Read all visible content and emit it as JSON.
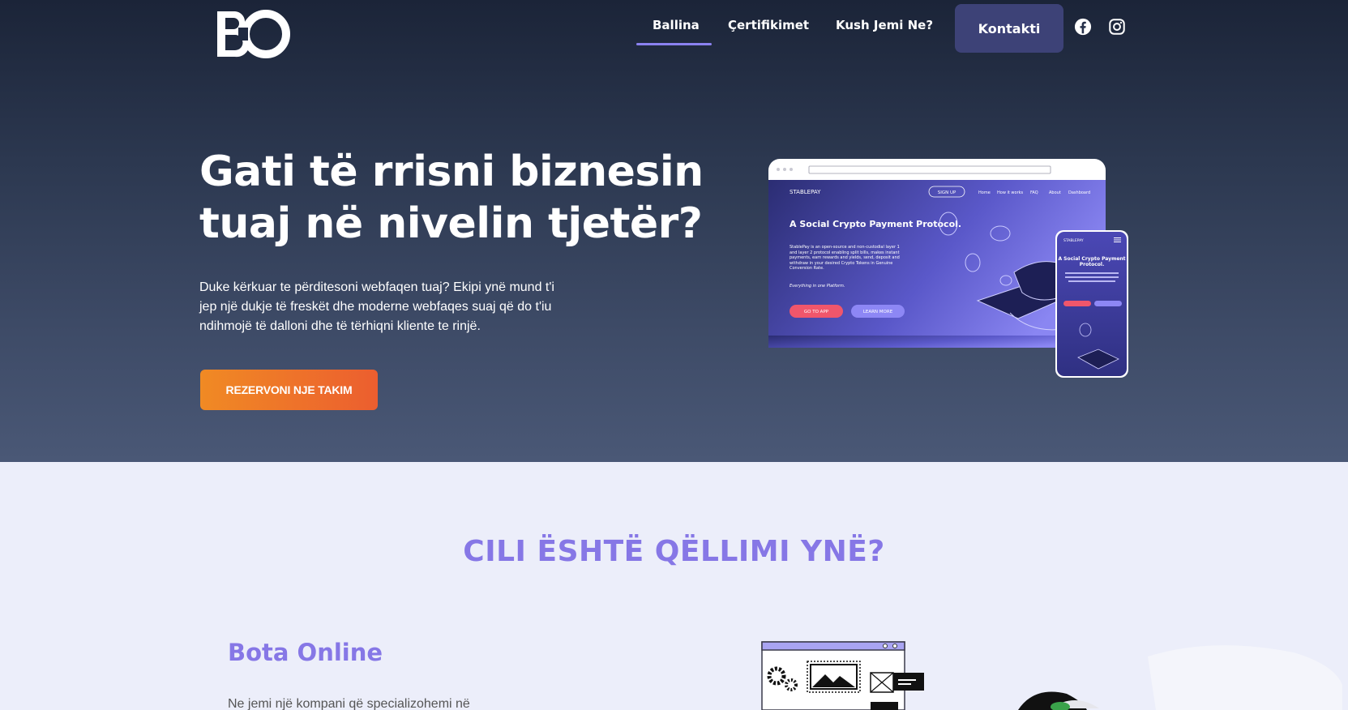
{
  "nav": {
    "logo_text": "BO",
    "links": [
      "Ballina",
      "Çertifikimet",
      "Kush Jemi Ne?"
    ],
    "cta": "Kontakti",
    "social": [
      "facebook-icon",
      "instagram-icon"
    ],
    "accent": "#8b82f0"
  },
  "hero": {
    "title": "Gati të rrisni biznesin tuaj në nivelin tjetër?",
    "text": "Duke kërkuar te përditesoni webfaqen tuaj? Ekipi ynë mund t'i jep një dukje të freskët dhe moderne webfaqes suaj që do t'iu ndihmojë të dalloni dhe të tërhiqni kliente te rinjë.",
    "button": "REZERVONI NJE TAKIM"
  },
  "mockup": {
    "brand": "STABLEPAY",
    "sign_up": "SIGN UP",
    "menu": [
      "Home",
      "How it works",
      "FAQ",
      "About",
      "Dashboard"
    ],
    "headline": "A Social Crypto Payment Protocol.",
    "body": "StablePay is an open-source and non-custodial layer 1 and layer 2 protocol enabling split bills, makes instant payments, earn rewards and yields, send, deposit and withdraw in your desired Crypto Tokens in Genuine Conversion Rate.",
    "tagline": "Everything in one Platform.",
    "btn_primary": "GO TO APP",
    "btn_secondary": "LEARN MORE"
  },
  "section": {
    "title": "CILI ËSHTË QËLLIMI YNË?",
    "subtitle": "Bota Online",
    "text": "Ne jemi një kompani që specializohemi në"
  }
}
